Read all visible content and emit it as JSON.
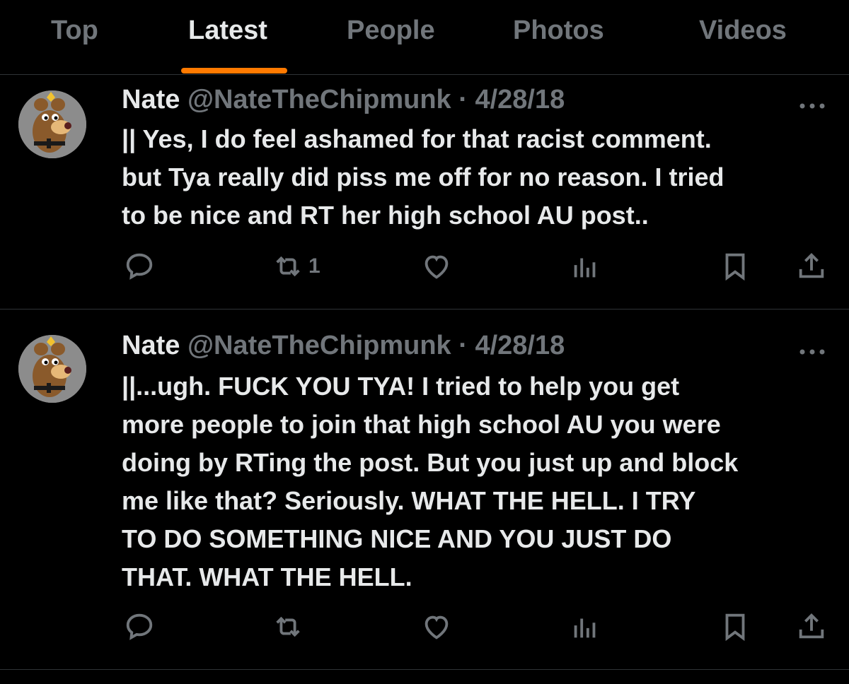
{
  "tabs": [
    {
      "label": "Top",
      "active": false
    },
    {
      "label": "Latest",
      "active": true
    },
    {
      "label": "People",
      "active": false
    },
    {
      "label": "Photos",
      "active": false
    },
    {
      "label": "Videos",
      "active": false
    }
  ],
  "accent_color": "#ff7a00",
  "tweets": [
    {
      "name": "Nate",
      "handle": "@NateTheChipmunk",
      "separator": "·",
      "date": "4/28/18",
      "more_icon": "more-icon",
      "text": "|| Yes, I do feel ashamed for that racist comment.\nbut Tya really did piss me off for no reason. I tried\nto be nice and RT her high school AU post..",
      "retweets": "1"
    },
    {
      "name": "Nate",
      "handle": "@NateTheChipmunk",
      "separator": "·",
      "date": "4/28/18",
      "more_icon": "more-icon",
      "text": "||...ugh. FUCK YOU TYA! I tried to help you get\nmore people to join that high school AU you were\ndoing by RTing the post. But you just up and block\nme like that? Seriously. WHAT THE HELL. I TRY\nTO DO SOMETHING NICE AND YOU JUST DO\nTHAT. WHAT THE HELL.",
      "retweets": ""
    }
  ]
}
